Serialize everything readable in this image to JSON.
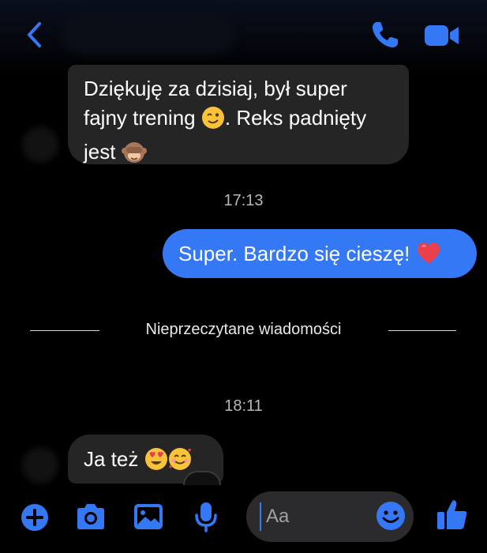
{
  "header": {
    "contact_name": "",
    "back_icon": "chevron-left-icon",
    "call_icon": "phone-icon",
    "video_icon": "video-camera-icon",
    "accent": "#3478f6"
  },
  "messages": [
    {
      "direction": "incoming",
      "text": "Dziękuję za dzisiaj, był super fajny trening 😉. Reks padnięty jest 🙈"
    },
    {
      "type": "timestamp",
      "text": "17:13"
    },
    {
      "direction": "outgoing",
      "text": "Super. Bardzo się cieszę! ❤️"
    },
    {
      "type": "divider",
      "text": "Nieprzeczytane wiadomości"
    },
    {
      "type": "timestamp",
      "text": "18:11"
    },
    {
      "direction": "incoming",
      "text": "Ja też 😍🥰"
    }
  ],
  "bubble_in": {
    "line1": "Dziękuję za dzisiaj, był super",
    "line2a": "fajny trening ",
    "line2_emoji": "wink-emoji",
    "line2b": ". Reks padnięty",
    "line3": "jest ",
    "line3_emoji": "see-no-evil-monkey-emoji"
  },
  "timestamp1": "17:13",
  "bubble_out": {
    "text": "Super. Bardzo się cieszę! ",
    "emoji": "red-heart-emoji"
  },
  "divider": {
    "label": "Nieprzeczytane wiadomości"
  },
  "timestamp2": "18:11",
  "bubble_in2": {
    "text": "Ja też ",
    "emojis": [
      "heart-eyes-emoji",
      "smiling-face-with-hearts-emoji"
    ]
  },
  "composer": {
    "placeholder": "Aa",
    "buttons": [
      "plus-icon",
      "camera-icon",
      "image-icon",
      "microphone-icon"
    ],
    "emoji_icon": "smiley-icon",
    "like_icon": "thumbs-up-icon"
  },
  "colors": {
    "background": "#000000",
    "incoming_bubble": "#252526",
    "outgoing_bubble": "#3478f6",
    "accent": "#3478f6"
  }
}
